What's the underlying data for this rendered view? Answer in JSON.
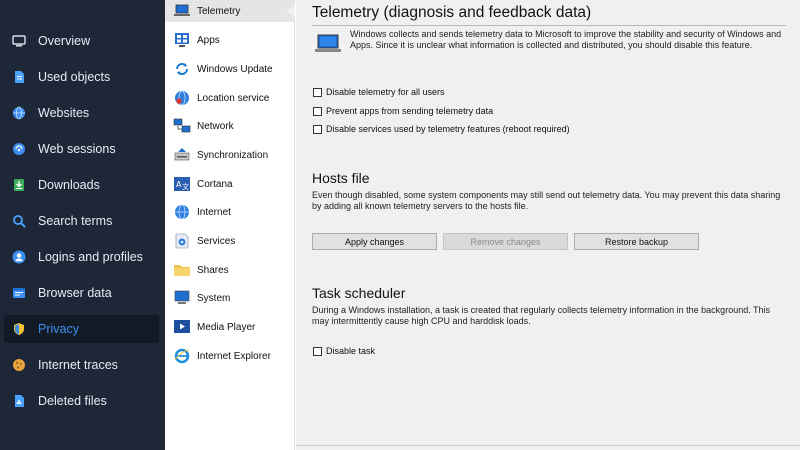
{
  "nav": {
    "items": [
      {
        "label": "Overview",
        "icon": "monitor-icon"
      },
      {
        "label": "Used objects",
        "icon": "document-icon"
      },
      {
        "label": "Websites",
        "icon": "globe-icon"
      },
      {
        "label": "Web sessions",
        "icon": "sessions-icon"
      },
      {
        "label": "Downloads",
        "icon": "download-icon"
      },
      {
        "label": "Search terms",
        "icon": "search-icon"
      },
      {
        "label": "Logins and profiles",
        "icon": "user-icon"
      },
      {
        "label": "Browser data",
        "icon": "browser-icon"
      },
      {
        "label": "Privacy",
        "icon": "shield-icon",
        "active": true
      },
      {
        "label": "Internet traces",
        "icon": "cookie-icon"
      },
      {
        "label": "Deleted files",
        "icon": "recycle-icon"
      }
    ],
    "accent": "#3d8ef0"
  },
  "sub": {
    "items": [
      {
        "label": "Telemetry",
        "icon": "laptop-icon",
        "active": true
      },
      {
        "label": "Apps",
        "icon": "apps-icon"
      },
      {
        "label": "Windows Update",
        "icon": "update-icon"
      },
      {
        "label": "Location service",
        "icon": "location-icon"
      },
      {
        "label": "Network",
        "icon": "network-icon"
      },
      {
        "label": "Synchronization",
        "icon": "sync-icon"
      },
      {
        "label": "Cortana",
        "icon": "cortana-icon"
      },
      {
        "label": "Internet",
        "icon": "internet-icon"
      },
      {
        "label": "Services",
        "icon": "services-icon"
      },
      {
        "label": "Shares",
        "icon": "folder-icon"
      },
      {
        "label": "System",
        "icon": "system-icon"
      },
      {
        "label": "Media Player",
        "icon": "media-player-icon"
      },
      {
        "label": "Internet Explorer",
        "icon": "internet-explorer-icon"
      }
    ]
  },
  "content": {
    "title": "Telemetry (diagnosis and feedback data)",
    "intro": "Windows collects and sends telemetry data to Microsoft to improve the stability and security of Windows and Apps. Since it is unclear what information is collected and distributed, you should disable this feature.",
    "telemetry_checkboxes": [
      {
        "label": "Disable telemetry for all users",
        "checked": false
      },
      {
        "label": "Prevent apps from sending telemetry data",
        "checked": false
      },
      {
        "label": "Disable services used by telemetry features (reboot required)",
        "checked": false
      }
    ],
    "hosts": {
      "title": "Hosts file",
      "text": "Even though disabled, some system components may still send out telemetry data. You may prevent this data sharing by adding all known telemetry servers to the hosts file.",
      "buttons": [
        {
          "label": "Apply changes",
          "enabled": true
        },
        {
          "label": "Remove changes",
          "enabled": false
        },
        {
          "label": "Restore backup",
          "enabled": true
        }
      ]
    },
    "scheduler": {
      "title": "Task scheduler",
      "text": "During a Windows installation, a task is created that regularly collects telemetry information in the background. This may intermittently cause high CPU and harddisk loads.",
      "checkbox": {
        "label": "Disable task",
        "checked": false
      }
    }
  }
}
